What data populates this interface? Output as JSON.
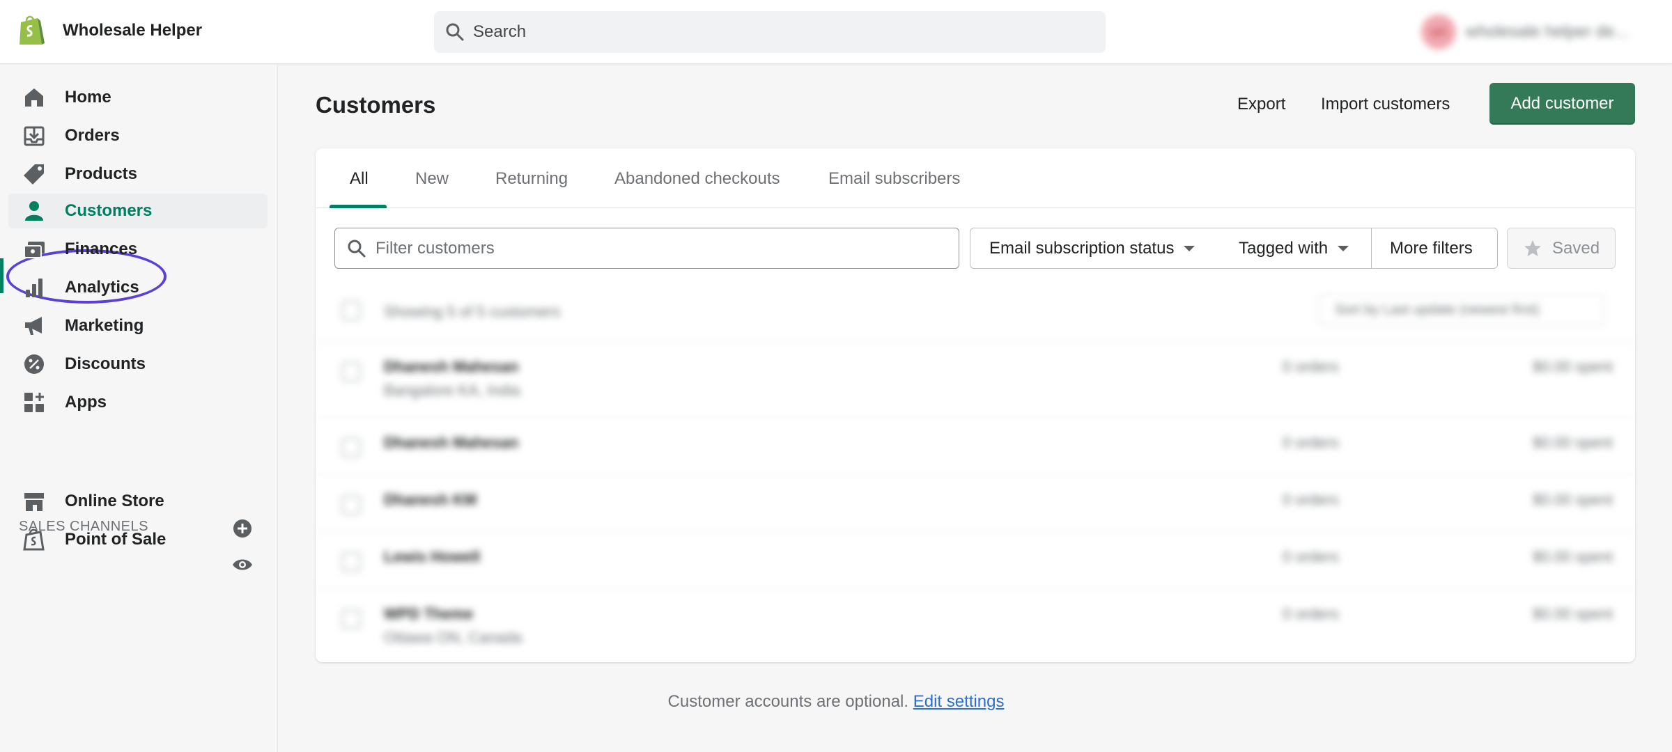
{
  "topbar": {
    "store_name": "Wholesale Helper",
    "search_placeholder": "Search",
    "account_initials": "wh",
    "account_name": "wholesale helper de..."
  },
  "sidebar": {
    "items": [
      {
        "label": "Home",
        "icon": "home-icon"
      },
      {
        "label": "Orders",
        "icon": "orders-icon"
      },
      {
        "label": "Products",
        "icon": "tag-icon"
      },
      {
        "label": "Customers",
        "icon": "person-icon",
        "active": true
      },
      {
        "label": "Finances",
        "icon": "finances-icon"
      },
      {
        "label": "Analytics",
        "icon": "bar-chart-icon"
      },
      {
        "label": "Marketing",
        "icon": "megaphone-icon"
      },
      {
        "label": "Discounts",
        "icon": "discount-icon"
      },
      {
        "label": "Apps",
        "icon": "apps-icon"
      }
    ],
    "section_heading": "SALES CHANNELS",
    "channels": [
      {
        "label": "Online Store",
        "icon": "store-icon"
      },
      {
        "label": "Point of Sale",
        "icon": "pos-bag-icon"
      }
    ]
  },
  "page": {
    "title": "Customers",
    "export_label": "Export",
    "import_label": "Import customers",
    "add_label": "Add customer"
  },
  "tabs": [
    "All",
    "New",
    "Returning",
    "Abandoned checkouts",
    "Email subscribers"
  ],
  "filters": {
    "search_placeholder": "Filter customers",
    "email_status": "Email subscription status",
    "tagged_with": "Tagged with",
    "more_filters": "More filters",
    "saved": "Saved"
  },
  "list": {
    "showing": "Showing 5 of 5 customers",
    "sort": "Sort by Last update (newest first)",
    "rows": [
      {
        "name": "Dhanesh Mahesan",
        "location": "Bangalore KA, India",
        "orders": "0 orders",
        "spent": "$0.00 spent"
      },
      {
        "name": "Dhanesh Mahesan",
        "location": "",
        "orders": "0 orders",
        "spent": "$0.00 spent"
      },
      {
        "name": "Dhanesh KM",
        "location": "",
        "orders": "0 orders",
        "spent": "$0.00 spent"
      },
      {
        "name": "Lewis Howell",
        "location": "",
        "orders": "0 orders",
        "spent": "$0.00 spent"
      },
      {
        "name": "WPD Theme",
        "location": "Ottawa ON, Canada",
        "orders": "0 orders",
        "spent": "$0.00 spent"
      }
    ]
  },
  "footer": {
    "text": "Customer accounts are optional.",
    "link": "Edit settings"
  },
  "colors": {
    "accent": "#008060",
    "primary_button": "#347a58",
    "annotation": "#5b3fd6",
    "link": "#2c6ecb"
  }
}
